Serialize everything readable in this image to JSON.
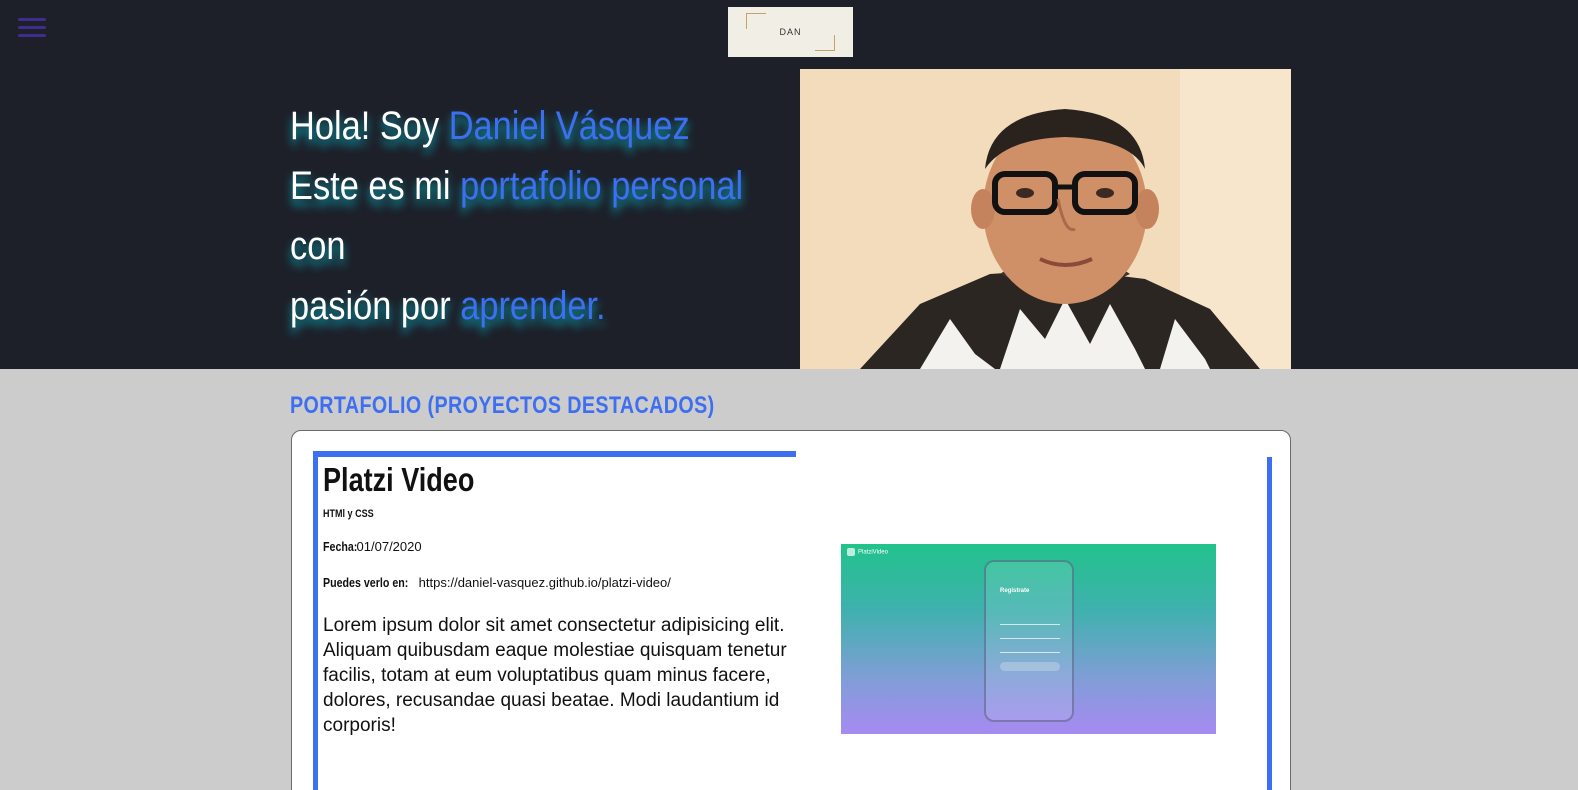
{
  "nav": {
    "menu_icon": "hamburger-icon"
  },
  "logo": {
    "text": "DAN",
    "accent_color": "#c9a06a"
  },
  "hero": {
    "line1_pre": "Hola! Soy ",
    "line1_highlight": "Daniel Vásquez",
    "line2_pre": "Este es mi ",
    "line2_highlight": "portafolio personal",
    "line3": "con",
    "line4_pre": "pasión por ",
    "line4_highlight": "aprender.",
    "text_color": "#ffffff",
    "highlight_color": "#3d6ff0",
    "glow_color": "#00c8dc"
  },
  "photo": {
    "description": "profile-photo"
  },
  "portfolio": {
    "section_title": "PORTAFOLIO (PROYECTOS DESTACADOS)",
    "accent_color": "#3d6ff0",
    "project": {
      "title": "Platzi Video",
      "tech": "HTMl y CSS",
      "date_label": "Fecha:",
      "date_value": "01/07/2020",
      "url_label": "Puedes verlo en:",
      "url_value": "https://daniel-vasquez.github.io/platzi-video/",
      "description": "Lorem ipsum dolor sit amet consectetur adipisicing elit. Aliquam quibusdam eaque molestiae quisquam tenetur facilis, totam at eum voluptatibus quam minus facere, dolores, recusandae quasi beatae. Modi laudantium id corporis!",
      "thumbnail": {
        "brand": "PlatziVideo",
        "form_title": "Regístrate",
        "button": "Registrarse"
      }
    }
  },
  "colors": {
    "header_bg": "#1d2029",
    "page_bg": "#cccccc",
    "card_bg": "#ffffff"
  }
}
